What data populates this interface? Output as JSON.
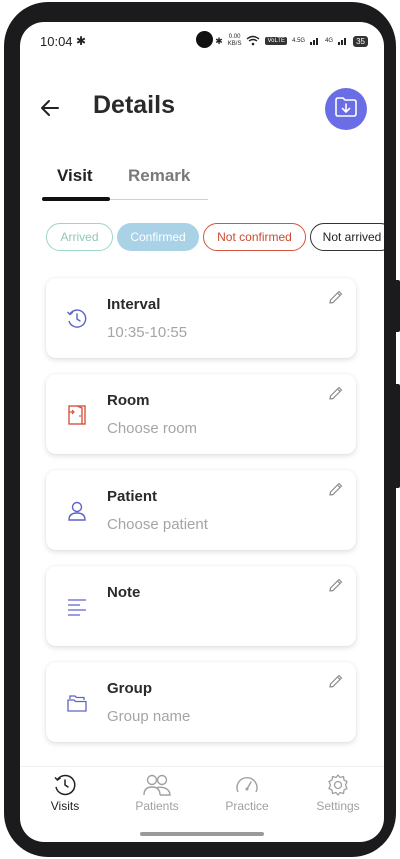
{
  "status_bar": {
    "time": "10:04",
    "net_speed_value": "0.00",
    "net_speed_unit": "KB/S",
    "volte": "VoLTE",
    "sig1": "4.5G",
    "sig2": "4G",
    "battery": "35"
  },
  "header": {
    "title": "Details"
  },
  "tabs": [
    {
      "label": "Visit",
      "active": true
    },
    {
      "label": "Remark",
      "active": false
    }
  ],
  "statuses": [
    "Arrived",
    "Confirmed",
    "Not confirmed",
    "Not arrived"
  ],
  "fields": [
    {
      "label": "Interval",
      "value": "10:35-10:55",
      "icon": "clock-icon"
    },
    {
      "label": "Room",
      "value": "Choose room",
      "icon": "door-icon"
    },
    {
      "label": "Patient",
      "value": "Choose patient",
      "icon": "person-icon"
    },
    {
      "label": "Note",
      "value": "",
      "icon": "note-lines-icon"
    },
    {
      "label": "Group",
      "value": "Group name",
      "icon": "folders-icon"
    }
  ],
  "nav": [
    {
      "label": "Visits",
      "icon": "clock-icon",
      "active": true
    },
    {
      "label": "Patients",
      "icon": "people-icon",
      "active": false
    },
    {
      "label": "Practice",
      "icon": "gauge-icon",
      "active": false
    },
    {
      "label": "Settings",
      "icon": "gear-icon",
      "active": false
    }
  ],
  "colors": {
    "accent": "#6a6ee6",
    "arrived": "#8ccab9",
    "confirmed": "#a9d2e6",
    "not_confirmed": "#cc4a34",
    "room_icon": "#d4553f"
  }
}
